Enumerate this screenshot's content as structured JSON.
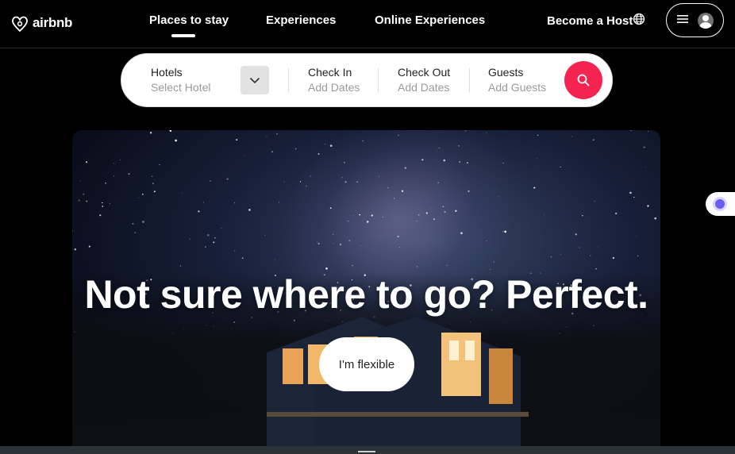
{
  "brand": {
    "name": "airbnb",
    "accent": "#f5234f"
  },
  "nav": {
    "items": [
      {
        "label": "Places to stay",
        "active": true
      },
      {
        "label": "Experiences",
        "active": false
      },
      {
        "label": "Online Experiences",
        "active": false
      }
    ],
    "host_label": "Become a Host",
    "icons": [
      "globe-icon",
      "menu-icon",
      "user-avatar-icon"
    ]
  },
  "search": {
    "hotel": {
      "label": "Hotels",
      "placeholder": "Select Hotel"
    },
    "check_in": {
      "label": "Check In",
      "placeholder": "Add Dates"
    },
    "check_out": {
      "label": "Check Out",
      "placeholder": "Add Dates"
    },
    "guests": {
      "label": "Guests",
      "placeholder": "Add Guests"
    }
  },
  "hero": {
    "title": "Not sure where to go? Perfect.",
    "button_label": "I'm flexible"
  }
}
